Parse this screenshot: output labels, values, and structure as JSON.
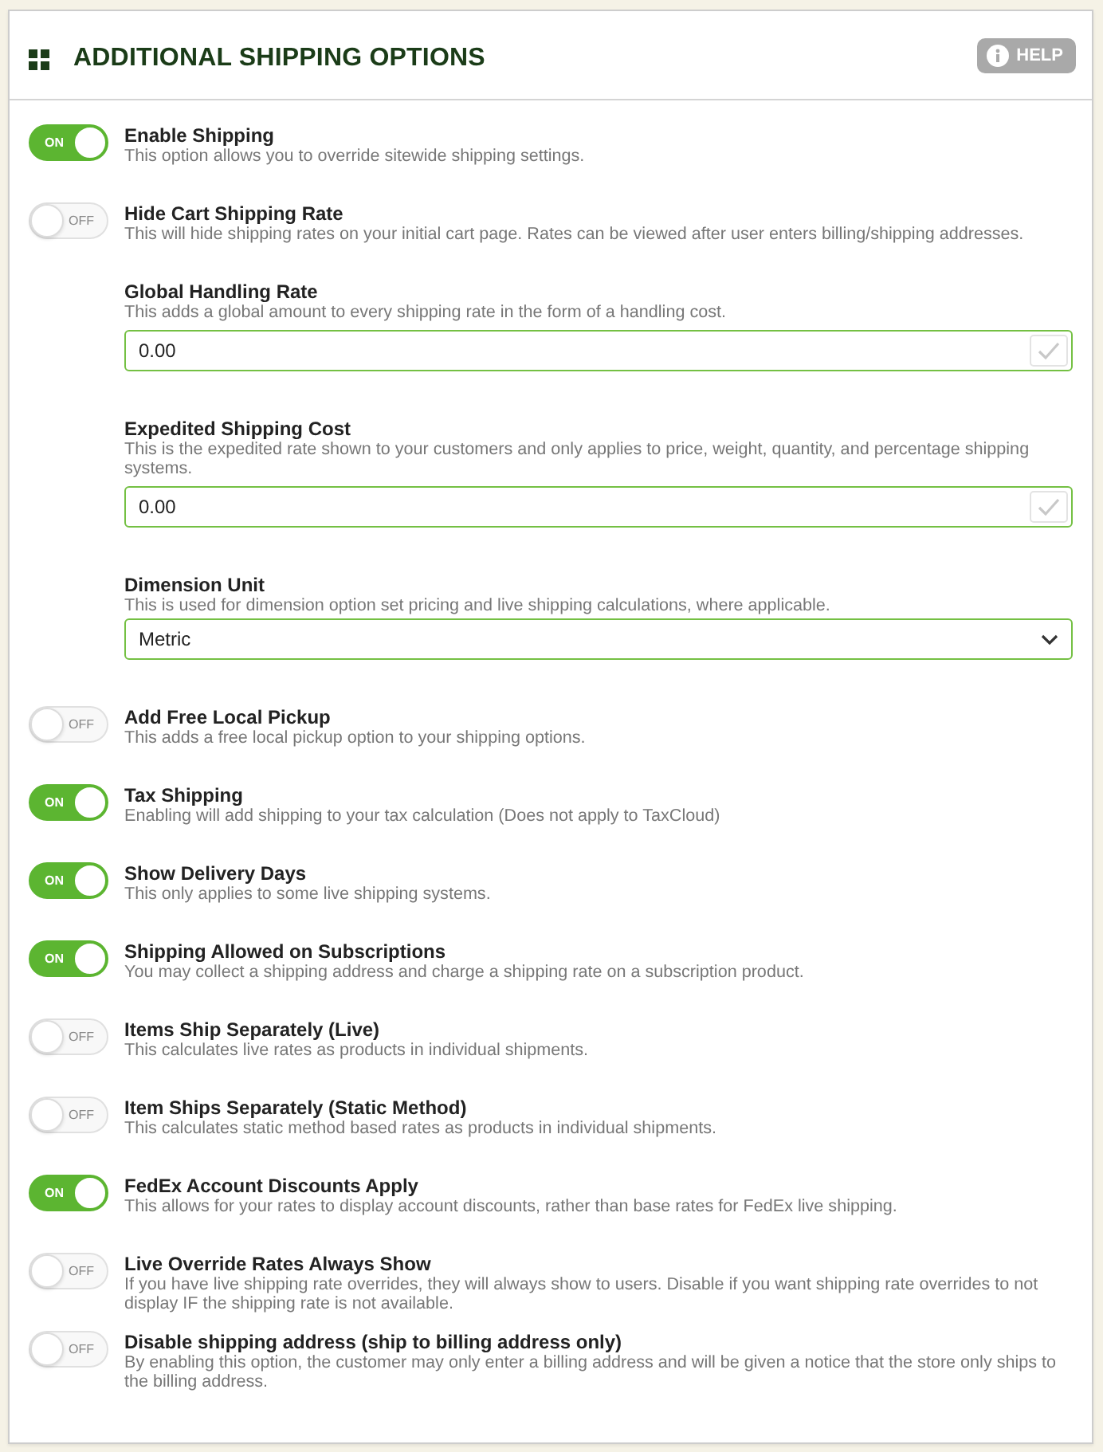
{
  "panel": {
    "title": "ADDITIONAL SHIPPING OPTIONS",
    "help_button": "HELP"
  },
  "settings": [
    {
      "kind": "toggle",
      "label": "Enable Shipping",
      "description": "This option allows you to override sitewide shipping settings.",
      "on": true,
      "switch_text": "ON"
    },
    {
      "kind": "toggle",
      "label": "Hide Cart Shipping Rate",
      "description": "This will hide shipping rates on your initial cart page. Rates can be viewed after user enters billing/shipping addresses.",
      "on": false,
      "switch_text": "OFF"
    },
    {
      "kind": "text_field",
      "label": "Global Handling Rate",
      "description": "This adds a global amount to every shipping rate in the form of a handling cost.",
      "value": "0.00"
    },
    {
      "kind": "text_field",
      "label": "Expedited Shipping Cost",
      "description": "This is the expedited rate shown to your customers and only applies to price, weight, quantity, and percentage shipping systems.",
      "value": "0.00"
    },
    {
      "kind": "select",
      "label": "Dimension Unit",
      "description": "This is used for dimension option set pricing and live shipping calculations, where applicable.",
      "value": "Metric"
    },
    {
      "kind": "toggle",
      "label": "Add Free Local Pickup",
      "description": "This adds a free local pickup option to your shipping options.",
      "on": false,
      "switch_text": "OFF"
    },
    {
      "kind": "toggle",
      "label": "Tax Shipping",
      "description": "Enabling will add shipping to your tax calculation (Does not apply to TaxCloud)",
      "on": true,
      "switch_text": "ON"
    },
    {
      "kind": "toggle",
      "label": "Show Delivery Days",
      "description": "This only applies to some live shipping systems.",
      "on": true,
      "switch_text": "ON"
    },
    {
      "kind": "toggle",
      "label": "Shipping Allowed on Subscriptions",
      "description": "You may collect a shipping address and charge a shipping rate on a subscription product.",
      "on": true,
      "switch_text": "ON"
    },
    {
      "kind": "toggle",
      "label": "Items Ship Separately (Live)",
      "description": "This calculates live rates as products in individual shipments.",
      "on": false,
      "switch_text": "OFF"
    },
    {
      "kind": "toggle",
      "label": "Item Ships Separately (Static Method)",
      "description": "This calculates static method based rates as products in individual shipments.",
      "on": false,
      "switch_text": "OFF"
    },
    {
      "kind": "toggle",
      "label": "FedEx Account Discounts Apply",
      "description": "This allows for your rates to display account discounts, rather than base rates for FedEx live shipping.",
      "on": true,
      "switch_text": "ON"
    },
    {
      "kind": "toggle",
      "label": "Live Override Rates Always Show",
      "description": "If you have live shipping rate overrides, they will always show to users. Disable if you want shipping rate overrides to not display IF the shipping rate is not available.",
      "on": false,
      "switch_text": "OFF"
    },
    {
      "kind": "toggle",
      "label": "Disable shipping address (ship to billing address only)",
      "description": "By enabling this option, the customer may only enter a billing address and will be given a notice that the store only ships to the billing address.",
      "on": false,
      "switch_text": "OFF"
    }
  ]
}
